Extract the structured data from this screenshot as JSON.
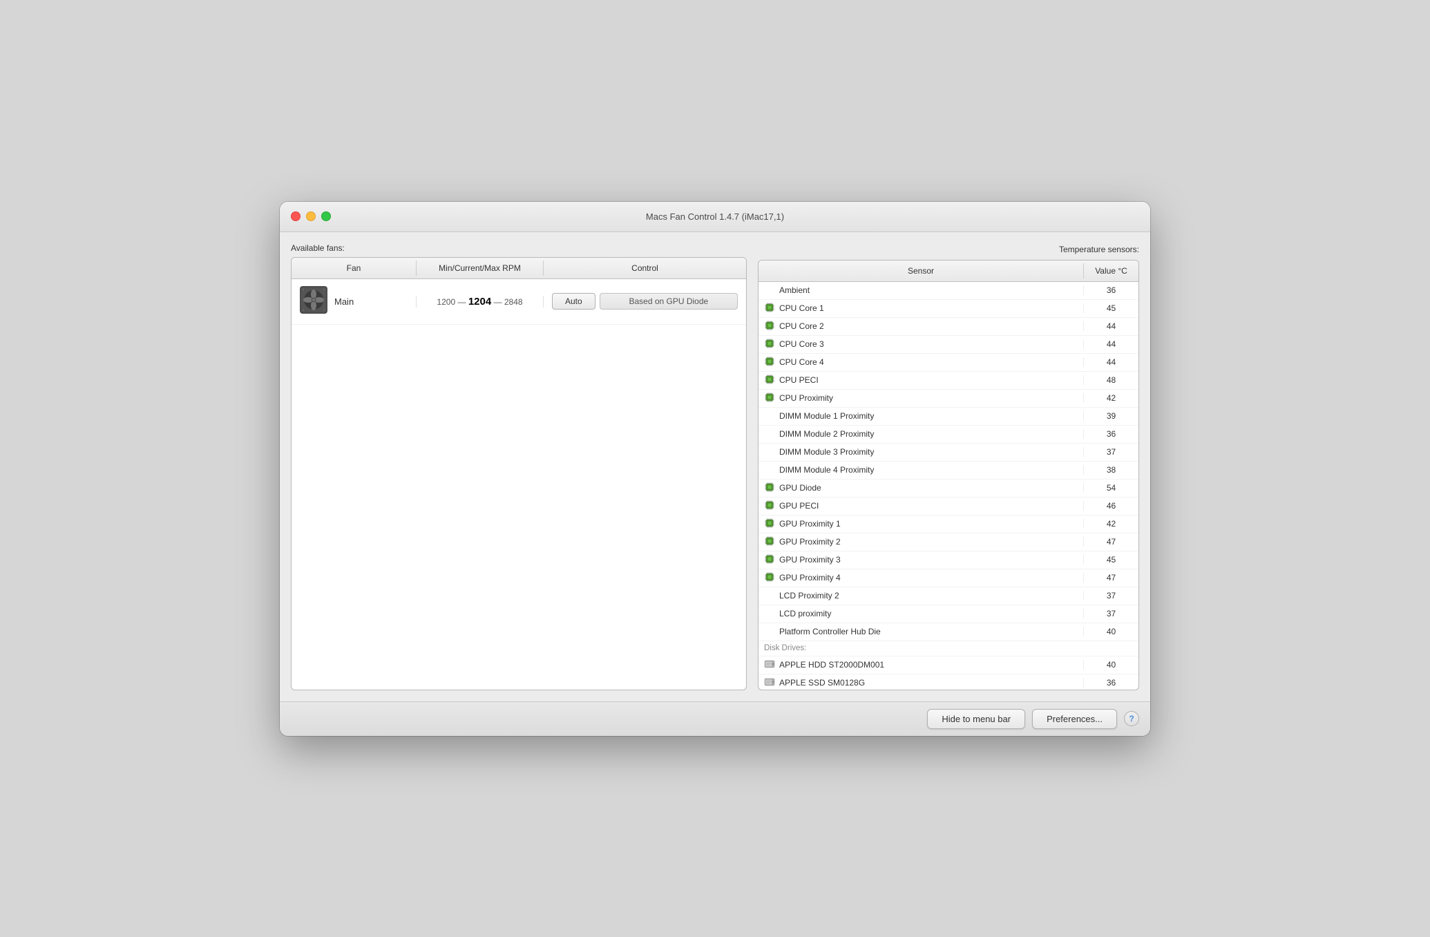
{
  "window": {
    "title": "Macs Fan Control 1.4.7 (iMac17,1)"
  },
  "fans_section": {
    "label": "Available fans:",
    "table": {
      "col_fan": "Fan",
      "col_rpm": "Min/Current/Max RPM",
      "col_control": "Control"
    },
    "fans": [
      {
        "name": "Main",
        "min_rpm": "1200",
        "current_rpm": "1204",
        "max_rpm": "2848",
        "control_mode": "Auto",
        "control_value": "Based on GPU Diode"
      }
    ]
  },
  "sensors_section": {
    "label": "Temperature sensors:",
    "table": {
      "col_sensor": "Sensor",
      "col_value": "Value °C"
    },
    "sensors": [
      {
        "name": "Ambient",
        "value": "36",
        "has_icon": false,
        "icon_type": "none"
      },
      {
        "name": "CPU Core 1",
        "value": "45",
        "has_icon": true,
        "icon_type": "chip"
      },
      {
        "name": "CPU Core 2",
        "value": "44",
        "has_icon": true,
        "icon_type": "chip"
      },
      {
        "name": "CPU Core 3",
        "value": "44",
        "has_icon": true,
        "icon_type": "chip"
      },
      {
        "name": "CPU Core 4",
        "value": "44",
        "has_icon": true,
        "icon_type": "chip"
      },
      {
        "name": "CPU PECI",
        "value": "48",
        "has_icon": true,
        "icon_type": "chip"
      },
      {
        "name": "CPU Proximity",
        "value": "42",
        "has_icon": true,
        "icon_type": "chip"
      },
      {
        "name": "DIMM Module 1 Proximity",
        "value": "39",
        "has_icon": false,
        "icon_type": "none"
      },
      {
        "name": "DIMM Module 2 Proximity",
        "value": "36",
        "has_icon": false,
        "icon_type": "none"
      },
      {
        "name": "DIMM Module 3 Proximity",
        "value": "37",
        "has_icon": false,
        "icon_type": "none"
      },
      {
        "name": "DIMM Module 4 Proximity",
        "value": "38",
        "has_icon": false,
        "icon_type": "none"
      },
      {
        "name": "GPU Diode",
        "value": "54",
        "has_icon": true,
        "icon_type": "chip"
      },
      {
        "name": "GPU PECI",
        "value": "46",
        "has_icon": true,
        "icon_type": "chip"
      },
      {
        "name": "GPU Proximity 1",
        "value": "42",
        "has_icon": true,
        "icon_type": "chip"
      },
      {
        "name": "GPU Proximity 2",
        "value": "47",
        "has_icon": true,
        "icon_type": "chip"
      },
      {
        "name": "GPU Proximity 3",
        "value": "45",
        "has_icon": true,
        "icon_type": "chip"
      },
      {
        "name": "GPU Proximity 4",
        "value": "47",
        "has_icon": true,
        "icon_type": "chip"
      },
      {
        "name": "LCD Proximity 2",
        "value": "37",
        "has_icon": false,
        "icon_type": "none"
      },
      {
        "name": "LCD proximity",
        "value": "37",
        "has_icon": false,
        "icon_type": "none"
      },
      {
        "name": "Platform Controller Hub Die",
        "value": "40",
        "has_icon": false,
        "icon_type": "none"
      }
    ],
    "disk_drives_label": "Disk Drives:",
    "disk_drives": [
      {
        "name": "APPLE HDD ST2000DM001",
        "value": "40",
        "icon_type": "disk"
      },
      {
        "name": "APPLE SSD SM0128G",
        "value": "36",
        "icon_type": "disk"
      }
    ]
  },
  "bottom": {
    "hide_btn": "Hide to menu bar",
    "prefs_btn": "Preferences...",
    "help_btn": "?"
  }
}
